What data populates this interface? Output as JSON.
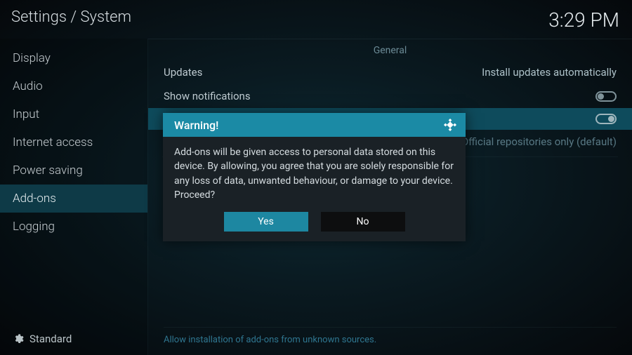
{
  "header": {
    "breadcrumb": "Settings / System",
    "clock": "3:29 PM"
  },
  "sidebar": {
    "items": [
      {
        "label": "Display"
      },
      {
        "label": "Audio"
      },
      {
        "label": "Input"
      },
      {
        "label": "Internet access"
      },
      {
        "label": "Power saving"
      },
      {
        "label": "Add-ons",
        "active": true
      },
      {
        "label": "Logging"
      }
    ],
    "footer_label": "Standard"
  },
  "content": {
    "section_header": "General",
    "rows": {
      "updates_label": "Updates",
      "updates_value": "Install updates automatically",
      "notifications_label": "Show notifications",
      "unknown_sources_value": "Official repositories only (default)"
    },
    "footer_hint": "Allow installation of add-ons from unknown sources."
  },
  "dialog": {
    "title": "Warning!",
    "body": "Add-ons will be given access to personal data stored on this device. By allowing, you agree that you are solely responsible for any loss of data, unwanted behaviour, or damage to your device. Proceed?",
    "yes": "Yes",
    "no": "No"
  }
}
